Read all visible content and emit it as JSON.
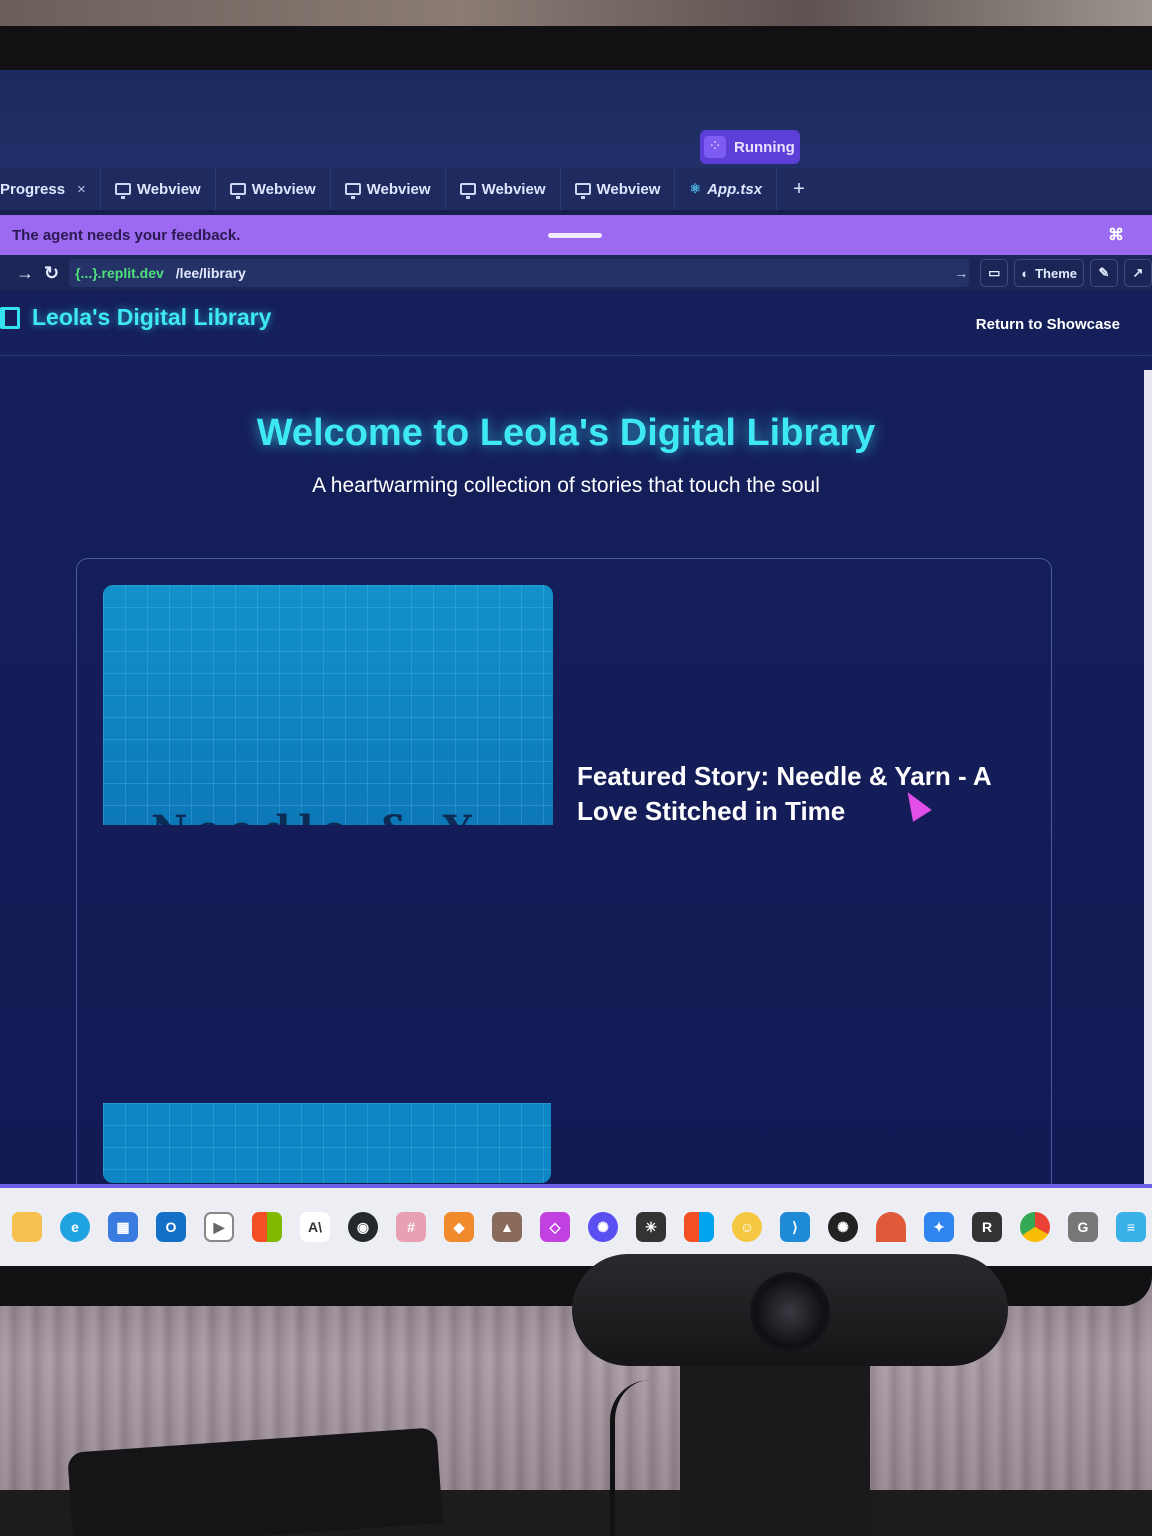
{
  "replit": {
    "run_button_label": "Running",
    "tabs": [
      {
        "label": "Progress",
        "icon": "none",
        "closable": true
      },
      {
        "label": "Webview",
        "icon": "monitor-icon"
      },
      {
        "label": "Webview",
        "icon": "monitor-icon"
      },
      {
        "label": "Webview",
        "icon": "monitor-icon"
      },
      {
        "label": "Webview",
        "icon": "monitor-icon"
      },
      {
        "label": "Webview",
        "icon": "monitor-icon"
      },
      {
        "label": "App.tsx",
        "icon": "react-icon"
      }
    ],
    "tab_close_glyph": "×",
    "tab_add_glyph": "+",
    "feedback_banner": "The agent needs your feedback.",
    "url": {
      "host": "{...}.replit.dev",
      "path": "/lee/library"
    },
    "toolbar": {
      "theme_label": "Theme"
    }
  },
  "app": {
    "brand_title": "Leola's Digital Library",
    "return_link": "Return to Showcase",
    "hero_title": "Welcome to Leola's Digital Library",
    "hero_subtitle": "A heartwarming collection of stories that touch the soul",
    "featured_title": "Featured Story: Needle & Yarn - A Love Stitched in Time",
    "cover_partial_text": "Needle & Y"
  },
  "colors": {
    "accent_cyan": "#3fe8f5",
    "background_navy": "#151f5a",
    "feedback_purple": "#9b6af0",
    "run_purple": "#5b3fd6",
    "cursor_magenta": "#e24fe8",
    "url_green": "#4ee07b"
  },
  "taskbar_icons": [
    "file-explorer-icon",
    "edge-icon",
    "store-icon",
    "outlook-icon",
    "media-player-icon",
    "microsoft-icon",
    "anthropic-icon",
    "github-icon",
    "slack-icon",
    "app-icon",
    "app-icon",
    "app-icon",
    "chatgpt-icon",
    "perplexity-icon",
    "microsoft-365-icon",
    "app-icon",
    "vscode-icon",
    "chatgpt-icon",
    "app-icon",
    "bluesky-icon",
    "replit-icon",
    "chrome-icon",
    "app-icon",
    "notepad-icon"
  ]
}
